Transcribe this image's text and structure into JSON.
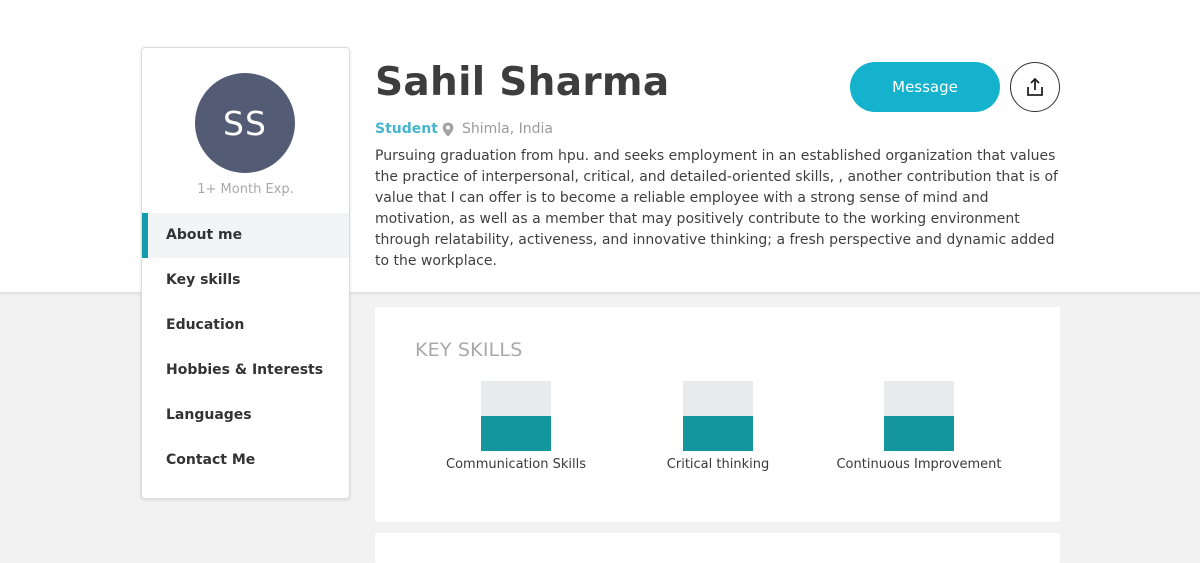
{
  "profile": {
    "initials": "SS",
    "experience": "1+ Month Exp.",
    "name": "Sahil Sharma",
    "role": "Student",
    "location": "Shimla, India",
    "bio": "Pursuing graduation from hpu. and seeks employment in an established organization that values the practice of interpersonal, critical, and detailed-oriented skills, , another contribution that is of value that I can offer is to become a reliable employee with a strong sense of mind and motivation, as well as a member that may positively contribute to the working environment through relatability, activeness, and innovative thinking; a fresh perspective and dynamic added to the workplace."
  },
  "actions": {
    "message_label": "Message",
    "share_icon": "share-icon"
  },
  "nav": {
    "active_index": 0,
    "items": [
      {
        "label": "About me"
      },
      {
        "label": "Key skills"
      },
      {
        "label": "Education"
      },
      {
        "label": "Hobbies & Interests"
      },
      {
        "label": "Languages"
      },
      {
        "label": "Contact Me"
      }
    ]
  },
  "skills": {
    "title": "KEY SKILLS",
    "items": [
      {
        "label": "Communication Skills",
        "level": 0.5
      },
      {
        "label": "Critical thinking",
        "level": 0.5
      },
      {
        "label": "Continuous Improvement",
        "level": 0.5
      }
    ]
  },
  "colors": {
    "accent": "#14b2cc",
    "role_text": "#47b6cd",
    "skill_bar": "#14969f",
    "avatar_bg": "#535c74",
    "nav_active_border": "#139bae"
  }
}
